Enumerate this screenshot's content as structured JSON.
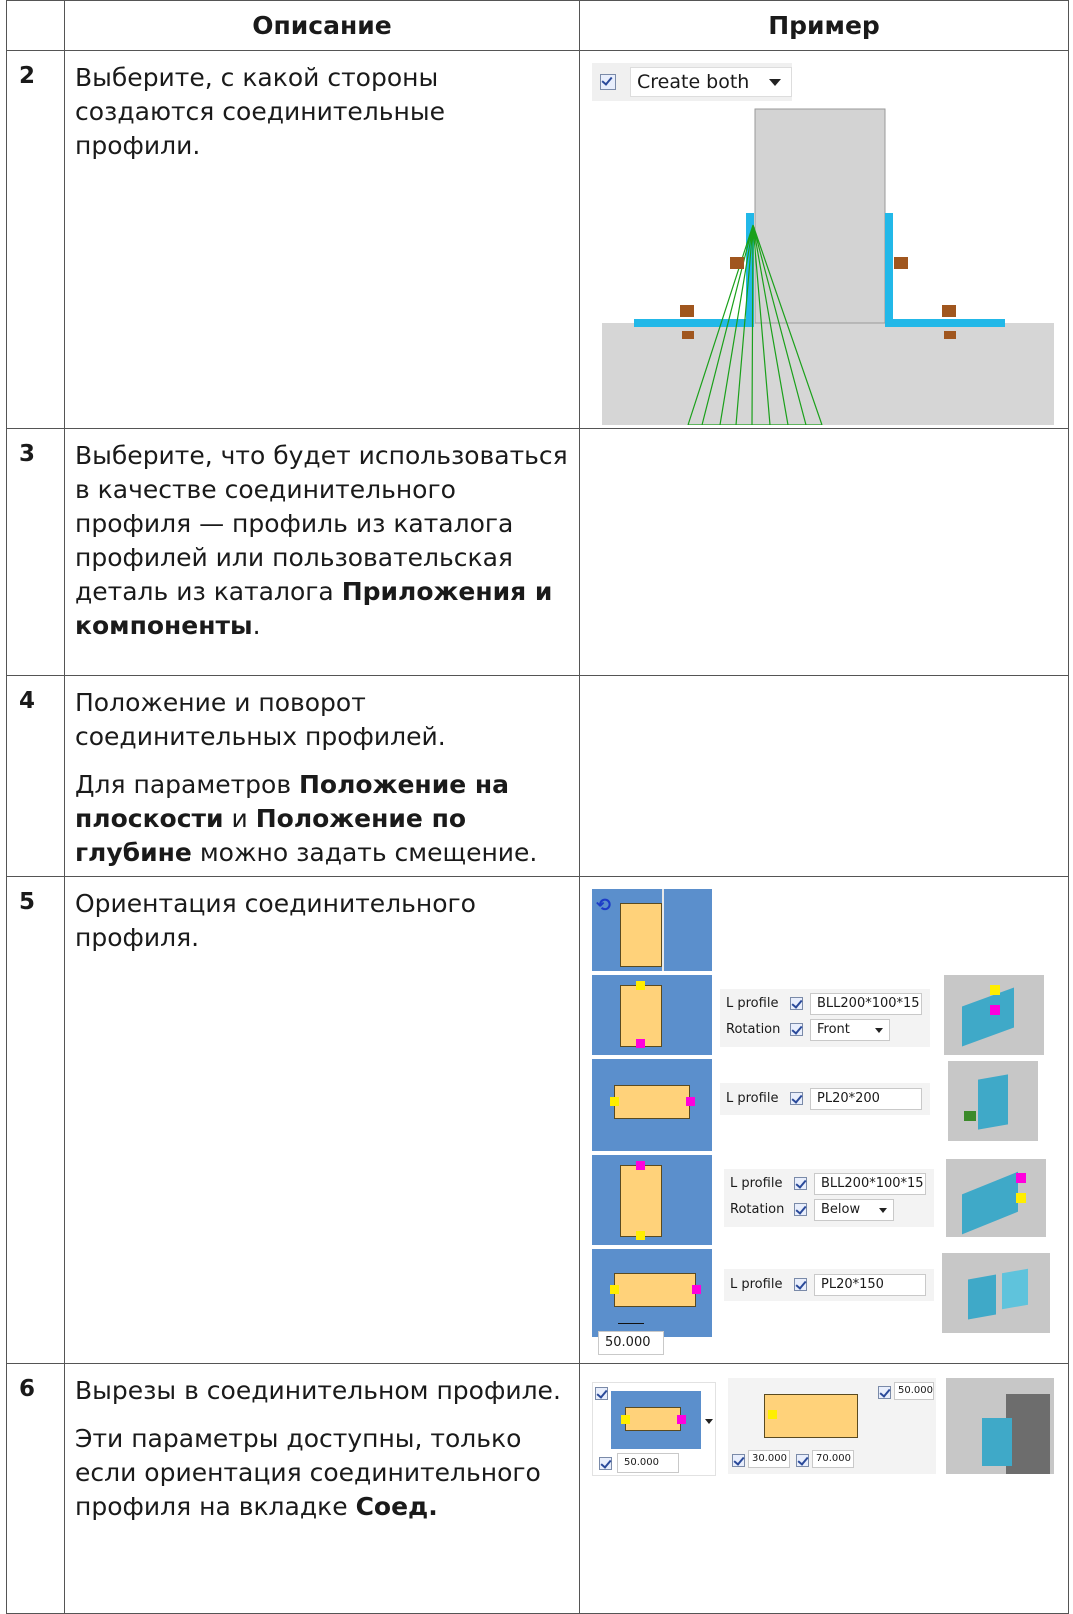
{
  "header": {
    "col_desc": "Описание",
    "col_example": "Пример"
  },
  "rows": [
    {
      "num": "2",
      "p1": "Выберите, с какой стороны создаются соединительные профили.",
      "dropdown_value": "Create both"
    },
    {
      "num": "3",
      "p1_pre": "Выберите, что будет использоваться в качестве соединительного профиля — профиль из каталога профилей или пользовательская деталь из каталога ",
      "p1_bold": "Приложения и компоненты",
      "p1_post": "."
    },
    {
      "num": "4",
      "p1": "Положение и поворот соединительных профилей.",
      "p2_a": "Для параметров ",
      "p2_b": "Положение на плоскости",
      "p2_c": " и ",
      "p2_d": "Положение по глубине",
      "p2_e": " можно задать смещение."
    },
    {
      "num": "5",
      "p1": "Ориентация соединительного профиля.",
      "options": [
        {
          "profile_label": "L profile",
          "profile_value": "BLL200*100*15",
          "rotation_label": "Rotation",
          "rotation_value": "Front"
        },
        {
          "profile_label": "L profile",
          "profile_value": "PL20*200"
        },
        {
          "profile_label": "L profile",
          "profile_value": "BLL200*100*15",
          "rotation_label": "Rotation",
          "rotation_value": "Below"
        },
        {
          "profile_label": "L profile",
          "profile_value": "PL20*150"
        }
      ],
      "offset_value": "50.000"
    },
    {
      "num": "6",
      "p1": "Вырезы в соединительном профиле.",
      "p2_a": "Эти параметры доступны, только если ориентация соединительного профиля на вкладке ",
      "p2_b": "Соед.",
      "cut_offset": "50.000",
      "cut_height": "50.000",
      "cut_x1": "30.000",
      "cut_x2": "70.000"
    }
  ]
}
